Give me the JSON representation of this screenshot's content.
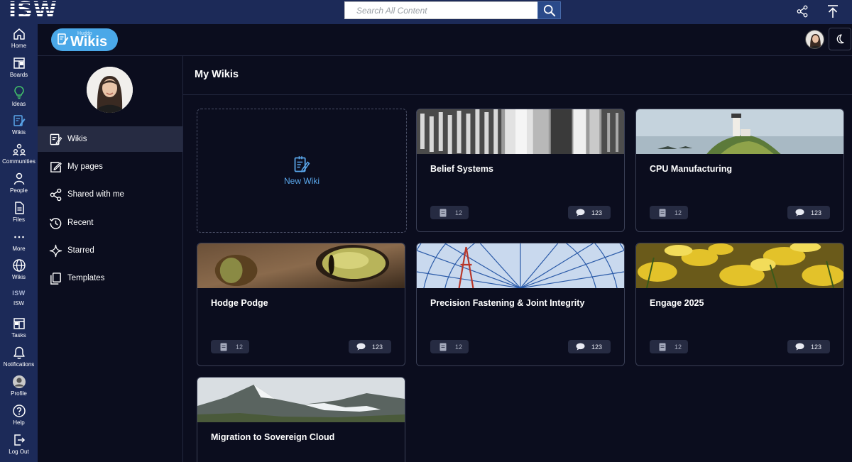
{
  "topbar": {
    "logo": "ISW",
    "search_placeholder": "Search All Content"
  },
  "rail": [
    {
      "label": "Home",
      "icon": "home-icon"
    },
    {
      "label": "Boards",
      "icon": "boards-icon"
    },
    {
      "label": "Ideas",
      "icon": "lightbulb-icon"
    },
    {
      "label": "Wikis",
      "icon": "wiki-edit-icon"
    },
    {
      "label": "Communities",
      "icon": "communities-icon"
    },
    {
      "label": "People",
      "icon": "person-icon"
    },
    {
      "label": "Files",
      "icon": "file-icon"
    },
    {
      "label": "More",
      "icon": "more-icon"
    },
    {
      "label": "Wikis",
      "icon": "globe-icon"
    },
    {
      "label": "ISW",
      "icon": "isw-logo-icon"
    },
    {
      "label": "Tasks",
      "icon": "tasks-icon"
    },
    {
      "label": "Notifications",
      "icon": "bell-icon"
    },
    {
      "label": "Profile",
      "icon": "profile-avatar-icon"
    },
    {
      "label": "Help",
      "icon": "help-icon"
    },
    {
      "label": "Log Out",
      "icon": "logout-icon"
    }
  ],
  "rail_isw_logo": "ISW",
  "wiki_header": {
    "badge_small": "Huddo",
    "badge_big": "Wikis"
  },
  "sidebar": {
    "items": [
      {
        "label": "Wikis",
        "icon": "wiki-doc-icon",
        "active": true
      },
      {
        "label": "My pages",
        "icon": "edit-icon",
        "active": false
      },
      {
        "label": "Shared with me",
        "icon": "share-icon",
        "active": false
      },
      {
        "label": "Recent",
        "icon": "history-icon",
        "active": false
      },
      {
        "label": "Starred",
        "icon": "sparkle-icon",
        "active": false
      },
      {
        "label": "Templates",
        "icon": "templates-icon",
        "active": false
      }
    ]
  },
  "main": {
    "title": "My Wikis",
    "new_wiki_label": "New Wiki",
    "cards": [
      {
        "title": "Belief Systems",
        "pages": "12",
        "comments": "123",
        "image": "architecture"
      },
      {
        "title": "CPU Manufacturing",
        "pages": "12",
        "comments": "123",
        "image": "lighthouse"
      },
      {
        "title": "Hodge Podge",
        "pages": "12",
        "comments": "123",
        "image": "cat-eye"
      },
      {
        "title": "Precision Fastening & Joint Integrity",
        "pages": "12",
        "comments": "123",
        "image": "ferris-wheel"
      },
      {
        "title": "Engage 2025",
        "pages": "12",
        "comments": "123",
        "image": "autumn-leaves"
      },
      {
        "title": "Migration to Sovereign Cloud",
        "pages": "",
        "comments": "",
        "image": "glacier-mountains"
      }
    ]
  },
  "colors": {
    "topbar": "#1c2a58",
    "background": "#0b0d1e",
    "accent": "#5aa6ea",
    "badge": "#4aa8e8"
  }
}
